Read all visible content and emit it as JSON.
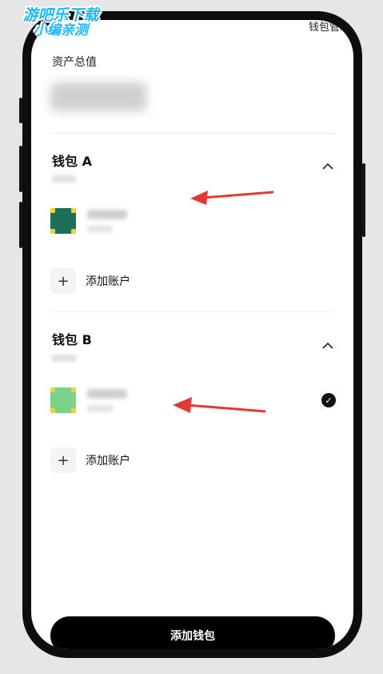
{
  "watermark": {
    "line1": "游吧乐下载",
    "line2": "小编亲测"
  },
  "header": {
    "top_right_text": "钱包管理"
  },
  "assets": {
    "label": "资产总值"
  },
  "wallets": [
    {
      "title": "钱包 A",
      "collapse_icon": "chevron-up-icon",
      "account": {
        "avatar_color": "#1e6f58",
        "selected": false
      },
      "add_account_label": "添加账户"
    },
    {
      "title": "钱包 B",
      "collapse_icon": "chevron-up-icon",
      "account": {
        "avatar_color": "#7bd38a",
        "selected": true
      },
      "add_account_label": "添加账户"
    }
  ],
  "footer": {
    "add_wallet_label": "添加钱包"
  },
  "annotations": {
    "arrow_color": "#e53935"
  }
}
